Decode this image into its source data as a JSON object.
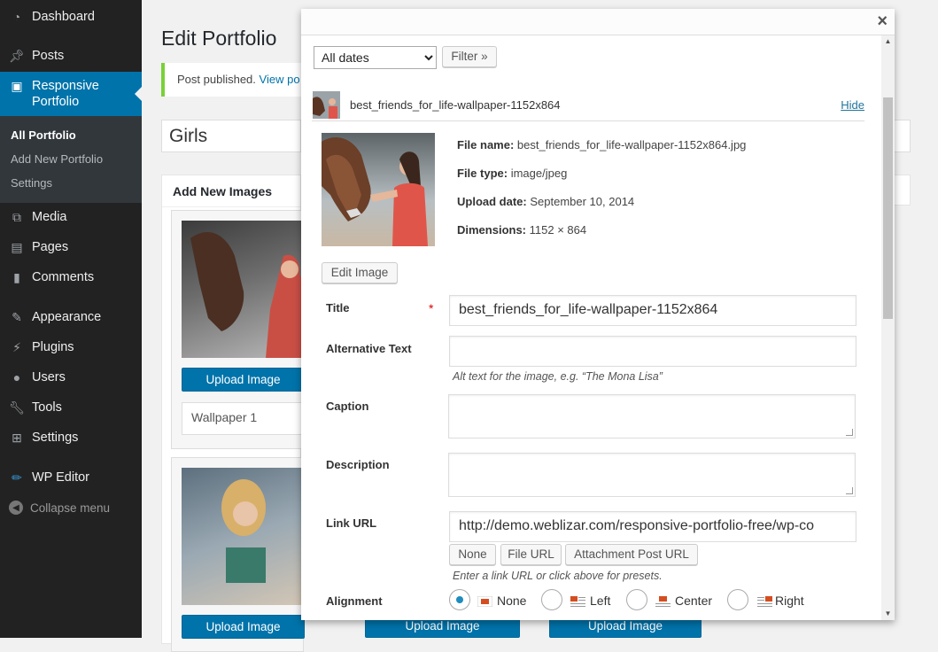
{
  "sidebar": {
    "items": [
      {
        "label": "Dashboard",
        "icon": "dashboard-icon"
      },
      {
        "label": "Posts",
        "icon": "pin-icon"
      },
      {
        "label": "Responsive Portfolio",
        "icon": "portfolio-icon"
      },
      {
        "label": "Media",
        "icon": "media-icon"
      },
      {
        "label": "Pages",
        "icon": "pages-icon"
      },
      {
        "label": "Comments",
        "icon": "comments-icon"
      },
      {
        "label": "Appearance",
        "icon": "appearance-icon"
      },
      {
        "label": "Plugins",
        "icon": "plugins-icon"
      },
      {
        "label": "Users",
        "icon": "users-icon"
      },
      {
        "label": "Tools",
        "icon": "tools-icon"
      },
      {
        "label": "Settings",
        "icon": "settings-icon"
      },
      {
        "label": "WP Editor",
        "icon": "pen-icon"
      }
    ],
    "submenu": [
      "All Portfolio",
      "Add New Portfolio",
      "Settings"
    ],
    "collapse_label": "Collapse menu",
    "accent": "#0073aa"
  },
  "page": {
    "title": "Edit Portfolio",
    "notice_text": "Post published.",
    "notice_link": "View po",
    "post_title": "Girls",
    "images_box_title": "Add New Images",
    "upload_label": "Upload Image",
    "image_name_value": "Wallpaper 1"
  },
  "modal": {
    "close_glyph": "×",
    "date_filter": {
      "selected": "All dates"
    },
    "filter_button": "Filter »",
    "file_row": {
      "name": "best_friends_for_life-wallpaper-1152x864",
      "hide_label": "Hide"
    },
    "meta": {
      "file_name_label": "File name:",
      "file_name": "best_friends_for_life-wallpaper-1152x864.jpg",
      "file_type_label": "File type:",
      "file_type": "image/jpeg",
      "upload_date_label": "Upload date:",
      "upload_date": "September 10, 2014",
      "dimensions_label": "Dimensions:",
      "dimensions": "1152 × 864"
    },
    "edit_image_button": "Edit Image",
    "fields": {
      "title_label": "Title",
      "required_mark": "*",
      "title_value": "best_friends_for_life-wallpaper-1152x864",
      "alt_label": "Alternative Text",
      "alt_value": "",
      "alt_help": "Alt text for the image, e.g. “The Mona Lisa”",
      "caption_label": "Caption",
      "description_label": "Description",
      "link_label": "Link URL",
      "link_value": "http://demo.weblizar.com/responsive-portfolio-free/wp-co",
      "link_buttons": [
        "None",
        "File URL",
        "Attachment Post URL"
      ],
      "link_help": "Enter a link URL or click above for presets.",
      "alignment_label": "Alignment",
      "alignment_options": [
        "None",
        "Left",
        "Center",
        "Right"
      ],
      "alignment_selected": "None"
    }
  }
}
